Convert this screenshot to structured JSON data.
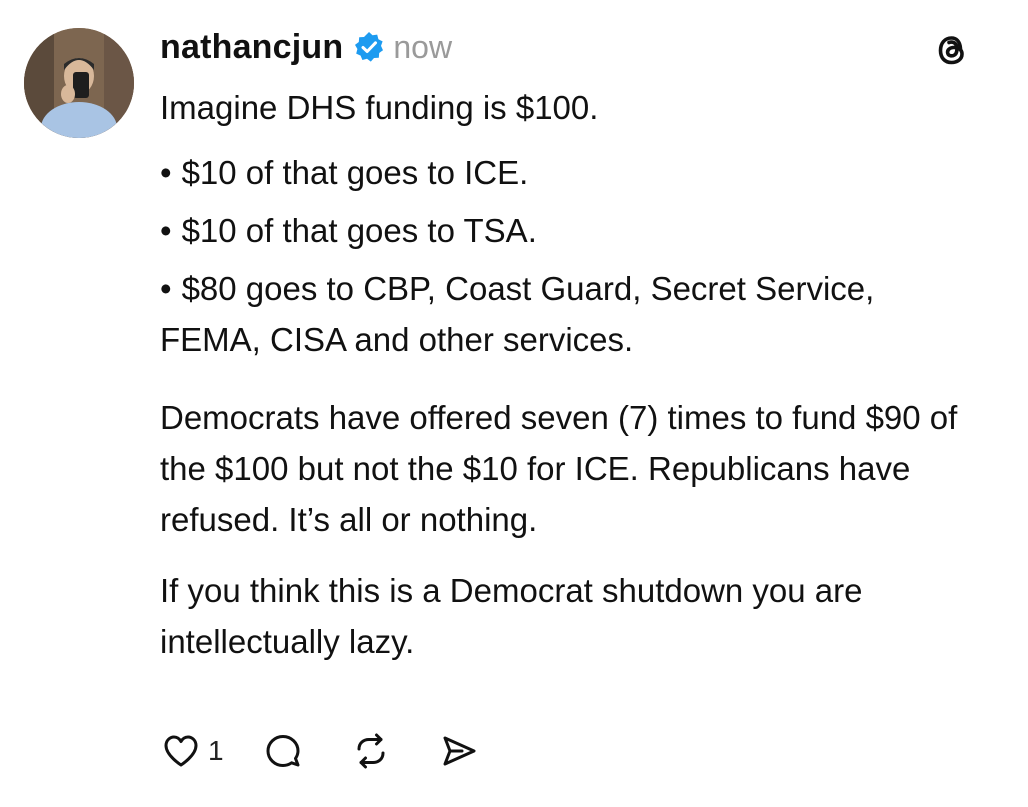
{
  "post": {
    "username": "nathancjun",
    "timestamp": "now",
    "verified_color": "#1d9bf0",
    "app_icon": "threads-icon",
    "body": {
      "intro": "Imagine DHS funding is $100.",
      "bullets": [
        "$10 of that goes to ICE.",
        "$10 of that goes to TSA.",
        "$80 goes to CBP, Coast Guard, Secret Service, FEMA, CISA and other services."
      ],
      "bullet_marker": "•",
      "paragraph2": "Democrats have offered seven (7) times to fund $90 of the $100 but not the $10 for ICE. Republicans have refused. It’s all or nothing.",
      "paragraph3": "If you think this is a Democrat shutdown you are intellectually lazy."
    },
    "actions": {
      "like_icon": "heart-icon",
      "like_count": "1",
      "reply_icon": "comment-icon",
      "repost_icon": "repost-icon",
      "share_icon": "share-icon"
    }
  }
}
